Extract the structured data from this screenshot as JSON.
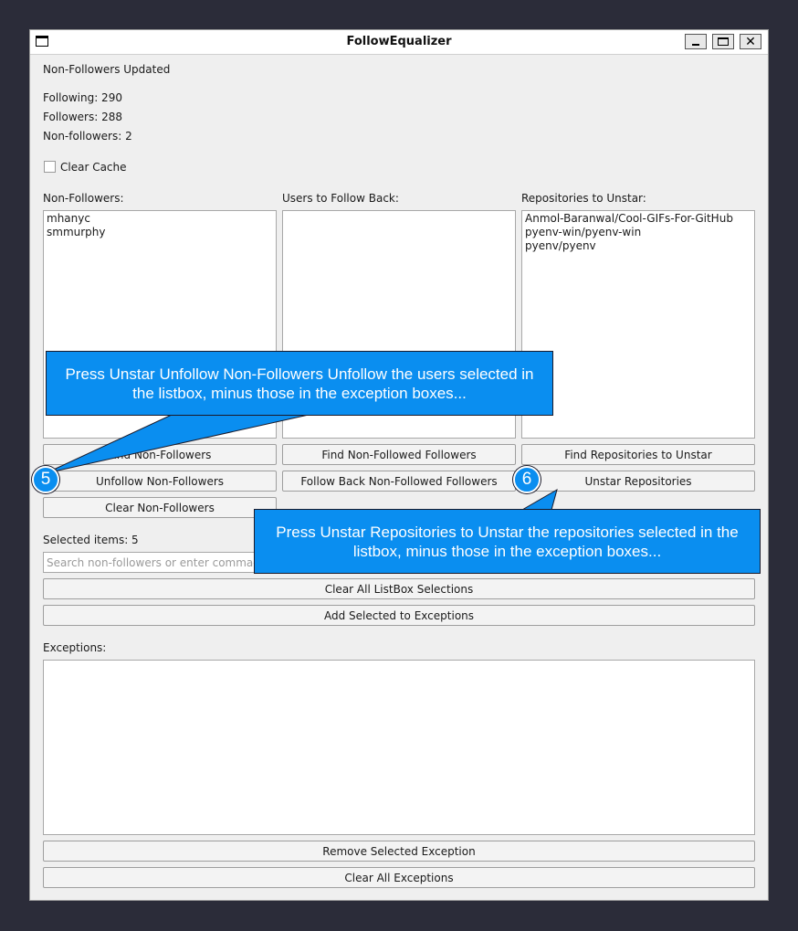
{
  "window": {
    "title": "FollowEqualizer"
  },
  "status": {
    "message": "Non-Followers Updated",
    "following": "Following: 290",
    "followers": "Followers: 288",
    "non_followers": "Non-followers: 2"
  },
  "clear_cache": {
    "label": "Clear Cache",
    "checked": false
  },
  "lists": {
    "non_followers": {
      "label": "Non-Followers:",
      "items": [
        "mhanyc",
        "smmurphy"
      ]
    },
    "follow_back": {
      "label": "Users to Follow Back:",
      "items": []
    },
    "repos": {
      "label": "Repositories to Unstar:",
      "items": [
        "Anmol-Baranwal/Cool-GIFs-For-GitHub",
        "pyenv-win/pyenv-win",
        "pyenv/pyenv"
      ]
    }
  },
  "buttons": {
    "find_non_followers": "Find Non-Followers",
    "unfollow_non_followers": "Unfollow Non-Followers",
    "clear_non_followers": "Clear Non-Followers",
    "find_non_followed_followers": "Find Non-Followed Followers",
    "follow_back": "Follow Back Non-Followed Followers",
    "find_repos": "Find Repositories to Unstar",
    "unstar_repos": "Unstar Repositories",
    "clear_all_selections": "Clear All ListBox Selections",
    "add_to_exceptions": "Add Selected to Exceptions",
    "remove_exception": "Remove Selected Exception",
    "clear_all_exceptions": "Clear All Exceptions"
  },
  "selection": {
    "label": "Selected items: 5"
  },
  "search": {
    "placeholder": "Search non-followers or enter comma-separated usernames",
    "value": ""
  },
  "exceptions": {
    "label": "Exceptions:",
    "items": []
  },
  "annotations": [
    {
      "number": "5",
      "text": "Press Unstar Unfollow Non-Followers Unfollow the users selected in the listbox, minus those in the exception boxes..."
    },
    {
      "number": "6",
      "text": "Press Unstar Repositories to Unstar the repositories selected in the listbox, minus those in the exception boxes..."
    }
  ],
  "colors": {
    "callout": "#0a8ef0",
    "background": "#2b2c39",
    "window": "#efefef"
  }
}
